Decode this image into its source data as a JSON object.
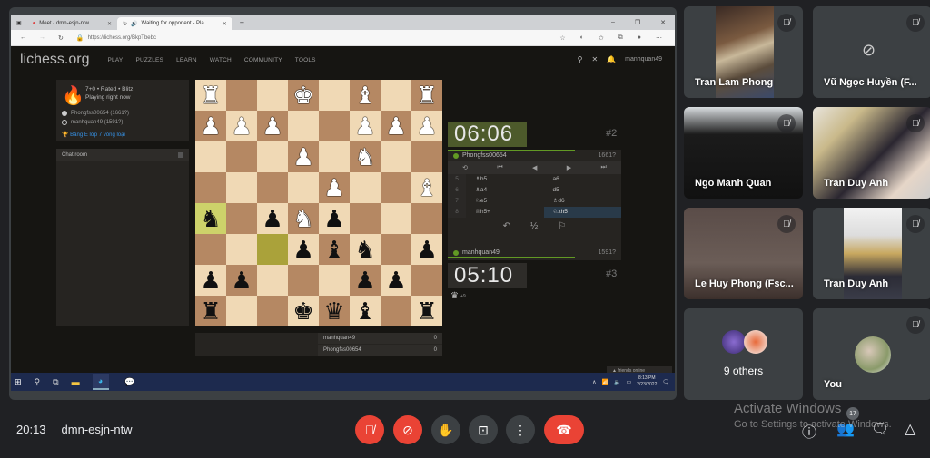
{
  "browser": {
    "tabs": [
      {
        "label": "Meet - dmn-esjn-ntw",
        "active": false
      },
      {
        "label": "Waiting for opponent - Pla",
        "active": true
      }
    ],
    "new_tab": "+",
    "url": "https://lichess.org/BkpTbebc",
    "window_controls": [
      "–",
      "❐",
      "✕"
    ]
  },
  "lichess": {
    "logo": "lichess.org",
    "nav": [
      "PLAY",
      "PUZZLES",
      "LEARN",
      "WATCH",
      "COMMUNITY",
      "TOOLS"
    ],
    "username": "manhquan49",
    "game_info": {
      "line1": "7+0 • Rated • Blitz",
      "line2": "Playing right now",
      "white_player": "Phongfss00654 (1661?)",
      "black_player": "manhquan49 (1591?)"
    },
    "tournament_link": "Bảng E lớp 7 vòng loại",
    "chat_room": "Chat room",
    "board": {
      "orientation": "black",
      "ranks": [
        [
          "wR",
          "",
          "",
          "wK",
          "",
          "wB",
          "",
          "wR"
        ],
        [
          "wP",
          "wP",
          "wP",
          "",
          "",
          "wP",
          "wP",
          "wP"
        ],
        [
          "",
          "",
          "",
          "wP",
          "",
          "wN",
          "",
          ""
        ],
        [
          "",
          "",
          "",
          "",
          "wP",
          "",
          "",
          "wB"
        ],
        [
          "bN",
          "",
          "bP",
          "wN",
          "bP",
          "",
          "",
          ""
        ],
        [
          "",
          "",
          "",
          "bP",
          "bB",
          "bN",
          "",
          "bP"
        ],
        [
          "bP",
          "bP",
          "",
          "",
          "",
          "bP",
          "bP",
          ""
        ],
        [
          "bR",
          "",
          "",
          "bK",
          "bQ",
          "bB",
          "",
          "bR"
        ]
      ],
      "highlight_from": [
        4,
        0
      ],
      "highlight_to": [
        5,
        2
      ]
    },
    "top_player": {
      "name": "Phongfss00654",
      "rating": "1661?",
      "clock": "06:06",
      "round": "#2"
    },
    "bottom_player": {
      "name": "manhquan49",
      "rating": "1591?",
      "clock": "05:10",
      "round": "#3"
    },
    "moves": [
      {
        "n": "5",
        "white": "♗b5",
        "black": "a6"
      },
      {
        "n": "6",
        "white": "♗a4",
        "black": "d5"
      },
      {
        "n": "7",
        "white": "♘e5",
        "black": "♗d6"
      },
      {
        "n": "8",
        "white": "♕h5+",
        "black": "♘xh5"
      }
    ],
    "current_move": "♘xh5",
    "nav_buttons": [
      "⟲",
      "⏮",
      "◀",
      "▶",
      "⏭"
    ],
    "actions": [
      "↶",
      "½",
      "⚐"
    ],
    "material_diff": "+9",
    "cross_table": [
      {
        "name": "manhquan49",
        "score": "0"
      },
      {
        "name": "Phongfss00654",
        "score": "0"
      }
    ],
    "friends_online": "▲ friends online"
  },
  "taskbar": {
    "time": "8:13 PM",
    "date": "2/23/2022"
  },
  "participants": [
    {
      "name": "Tran Lam Phong",
      "muted": true,
      "video": true
    },
    {
      "name": "Vũ Ngọc Huyền (F...",
      "muted": true,
      "video": false
    },
    {
      "name": "Ngo Manh Quan",
      "muted": true,
      "video": true
    },
    {
      "name": "Tran Duy Anh",
      "muted": true,
      "video": true
    },
    {
      "name": "Le Huy Phong (Fsc...",
      "muted": true,
      "video": true
    },
    {
      "name": "Tran Duy Anh",
      "muted": true,
      "video": true
    },
    {
      "name": "9 others",
      "muted": false,
      "video": false
    },
    {
      "name": "You",
      "muted": true,
      "video": false
    }
  ],
  "meet": {
    "time": "20:13",
    "meeting_code": "dmn-esjn-ntw",
    "participant_count": "17",
    "colors": {
      "danger": "#ea4335",
      "control": "#3c4043",
      "background": "#202124"
    }
  },
  "watermark": {
    "line1": "Activate Windows",
    "line2": "Go to Settings to activate Windows."
  }
}
